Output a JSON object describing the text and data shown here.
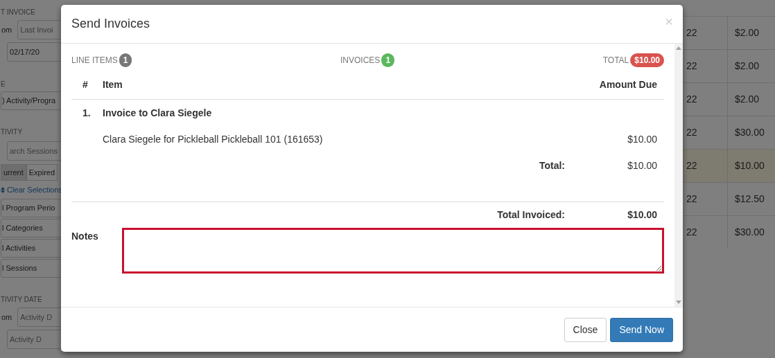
{
  "background": {
    "sidebar": [
      {
        "kind": "heading",
        "text": "T INVOICE"
      },
      {
        "kind": "field",
        "label": "om",
        "placeholder": "Last Invoi"
      },
      {
        "kind": "field",
        "value": "02/17/20"
      },
      {
        "kind": "heading",
        "text": "E"
      },
      {
        "kind": "select",
        "text": ") Activity/Progra"
      },
      {
        "kind": "heading",
        "text": "TIVITY"
      },
      {
        "kind": "field",
        "placeholder": "arch Sessions"
      },
      {
        "kind": "toggle",
        "options": [
          {
            "label": "urrent",
            "selected": true
          },
          {
            "label": "Expired",
            "selected": false
          }
        ]
      },
      {
        "kind": "link",
        "text": "Clear Selections"
      },
      {
        "kind": "select",
        "text": "l Program Perio"
      },
      {
        "kind": "select",
        "text": "l Categories"
      },
      {
        "kind": "select",
        "text": "l Activities"
      },
      {
        "kind": "select",
        "text": "l Sessions"
      },
      {
        "kind": "heading",
        "text": "TIVITY DATE"
      },
      {
        "kind": "field",
        "label": "om",
        "placeholder": "Activity D"
      },
      {
        "kind": "field",
        "placeholder": "Activity D"
      }
    ],
    "table": {
      "rows": [
        {
          "date": "22",
          "amount": "$2.00",
          "highlighted": false
        },
        {
          "date": "22",
          "amount": "$2.00",
          "highlighted": false
        },
        {
          "date": "22",
          "amount": "$2.00",
          "highlighted": false
        },
        {
          "date": "22",
          "amount": "$30.00",
          "highlighted": false
        },
        {
          "date": "22",
          "amount": "$10.00",
          "highlighted": true
        },
        {
          "date": "22",
          "amount": "$12.50",
          "highlighted": false
        },
        {
          "date": "22",
          "amount": "$30.00",
          "highlighted": false
        }
      ]
    }
  },
  "modal": {
    "title": "Send Invoices",
    "close_icon": "×",
    "summary": [
      {
        "label": "LINE ITEMS",
        "count": "1",
        "color": "#777777"
      },
      {
        "label": "INVOICES",
        "count": "1",
        "color": "#5cb85c"
      },
      {
        "label": "TOTAL",
        "count": "$10.00",
        "color": "#d9534f"
      }
    ],
    "columns": [
      "#",
      "Item",
      "Amount Due"
    ],
    "invoices": [
      {
        "number": "1.",
        "title": "Invoice to Clara Siegele",
        "lines": [
          {
            "item": "Clara Siegele for Pickleball Pickleball 101 (161653)",
            "amount": "$10.00"
          }
        ],
        "total_label": "Total:",
        "total": "$10.00"
      }
    ],
    "total_invoiced_label": "Total Invoiced:",
    "total_invoiced": "$10.00",
    "notes": {
      "label": "Notes",
      "invalid": true
    },
    "buttons": [
      {
        "label": "Close",
        "kind": "default"
      },
      {
        "label": "Send Now",
        "kind": "primary"
      }
    ]
  }
}
